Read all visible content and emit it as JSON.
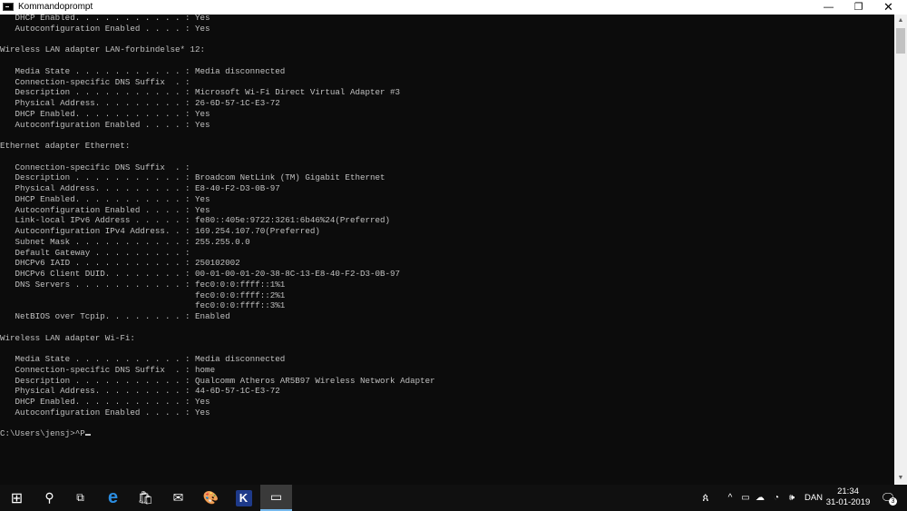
{
  "window": {
    "title": "Kommandoprompt",
    "minimize_glyph": "—",
    "restore_glyph": "❐",
    "close_glyph": "✕"
  },
  "console": {
    "lines": [
      "   DHCP Enabled. . . . . . . . . . . : Yes",
      "   Autoconfiguration Enabled . . . . : Yes",
      "",
      "Wireless LAN adapter LAN-forbindelse* 12:",
      "",
      "   Media State . . . . . . . . . . . : Media disconnected",
      "   Connection-specific DNS Suffix  . :",
      "   Description . . . . . . . . . . . : Microsoft Wi-Fi Direct Virtual Adapter #3",
      "   Physical Address. . . . . . . . . : 26-6D-57-1C-E3-72",
      "   DHCP Enabled. . . . . . . . . . . : Yes",
      "   Autoconfiguration Enabled . . . . : Yes",
      "",
      "Ethernet adapter Ethernet:",
      "",
      "   Connection-specific DNS Suffix  . :",
      "   Description . . . . . . . . . . . : Broadcom NetLink (TM) Gigabit Ethernet",
      "   Physical Address. . . . . . . . . : E8-40-F2-D3-0B-97",
      "   DHCP Enabled. . . . . . . . . . . : Yes",
      "   Autoconfiguration Enabled . . . . : Yes",
      "   Link-local IPv6 Address . . . . . : fe80::405e:9722:3261:6b46%24(Preferred)",
      "   Autoconfiguration IPv4 Address. . : 169.254.107.70(Preferred)",
      "   Subnet Mask . . . . . . . . . . . : 255.255.0.0",
      "   Default Gateway . . . . . . . . . :",
      "   DHCPv6 IAID . . . . . . . . . . . : 250102002",
      "   DHCPv6 Client DUID. . . . . . . . : 00-01-00-01-20-38-8C-13-E8-40-F2-D3-0B-97",
      "   DNS Servers . . . . . . . . . . . : fec0:0:0:ffff::1%1",
      "                                       fec0:0:0:ffff::2%1",
      "                                       fec0:0:0:ffff::3%1",
      "   NetBIOS over Tcpip. . . . . . . . : Enabled",
      "",
      "Wireless LAN adapter Wi-Fi:",
      "",
      "   Media State . . . . . . . . . . . : Media disconnected",
      "   Connection-specific DNS Suffix  . : home",
      "   Description . . . . . . . . . . . : Qualcomm Atheros AR5B97 Wireless Network Adapter",
      "   Physical Address. . . . . . . . . : 44-6D-57-1C-E3-72",
      "   DHCP Enabled. . . . . . . . . . . : Yes",
      "   Autoconfiguration Enabled . . . . : Yes",
      ""
    ],
    "prompt": "C:\\Users\\jensj>^P"
  },
  "taskbar": {
    "start_glyph": "⊞",
    "search_glyph": "⚲",
    "taskview_glyph": "⧉",
    "edge_glyph": "e",
    "store_glyph": "🛍",
    "mail_glyph": "✉",
    "paint_glyph": "🎨",
    "k_app_label": "K",
    "cmd_glyph": "▭",
    "people_glyph": "ጰ",
    "tray_chevron": "^",
    "battery_glyph": "▭",
    "onedrive_glyph": "☁",
    "wifi_glyph": "◔",
    "volume_glyph": "🕪",
    "language": "DAN",
    "time": "21:34",
    "date": "31-01-2019",
    "notification_glyph": "🗨",
    "notification_count": "3"
  },
  "scrollbar": {
    "up_glyph": "▲",
    "down_glyph": "▼"
  },
  "colors": {
    "console_bg": "#0c0c0c",
    "console_fg": "#c0c0c0",
    "taskbar_bg": "#101010",
    "accent": "#76b9ed"
  }
}
